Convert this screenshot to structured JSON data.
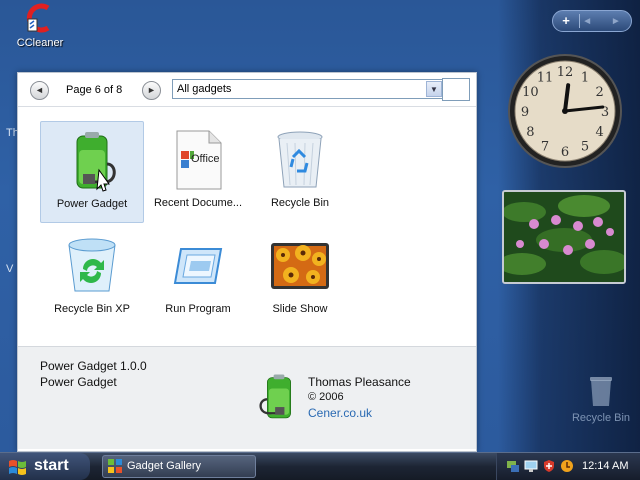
{
  "desktop": {
    "ccleaner_label": "CCleaner",
    "recycle_label": "Recycle Bin",
    "edge_text_1": "Th",
    "edge_text_2": "V"
  },
  "sidebar": {
    "add_label": "+",
    "nav_arrows": "◄ ►",
    "clock_numerals": [
      "12",
      "1",
      "2",
      "3",
      "4",
      "5",
      "6",
      "7",
      "8",
      "9",
      "10",
      "11"
    ],
    "clock_time": {
      "hour": 12,
      "minute": 14
    }
  },
  "gallery": {
    "page_label": "Page 6 of 8",
    "prev_icon": "◄",
    "next_icon": "►",
    "filter_value": "All gadgets",
    "dropdown_icon": "▼",
    "tiles": [
      {
        "label": "Power Gadget",
        "icon": "power-gadget-icon",
        "selected": true
      },
      {
        "label": "Recent Docume...",
        "icon": "office-document-icon",
        "selected": false
      },
      {
        "label": "Recycle Bin",
        "icon": "recycle-bin-icon",
        "selected": false
      },
      {
        "label": "Recycle Bin XP",
        "icon": "recycle-bin-xp-icon",
        "selected": false
      },
      {
        "label": "Run Program",
        "icon": "run-program-icon",
        "selected": false
      },
      {
        "label": "Slide Show",
        "icon": "slide-show-icon",
        "selected": false
      }
    ],
    "office_text": "Office",
    "details": {
      "name": "Power Gadget 1.0.0",
      "title": "Power Gadget",
      "author": "Thomas Pleasance",
      "copyright": "© 2006",
      "link": "Cener.co.uk"
    }
  },
  "taskbar": {
    "start_label": "start",
    "task_label": "Gadget Gallery",
    "time": "12:14 AM"
  },
  "colors": {
    "desktop": "#2f61a6",
    "selected_tile": "#dde9f6",
    "link": "#2a6ab3"
  }
}
